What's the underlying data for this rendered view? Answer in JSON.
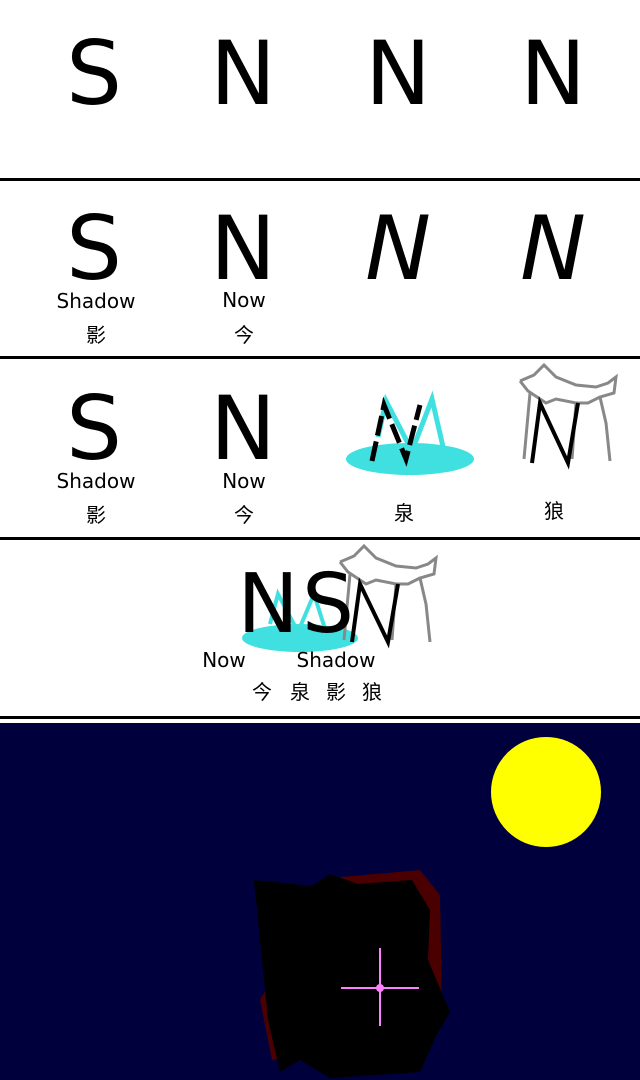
{
  "panel1": {
    "letters": [
      "S",
      "N",
      "N",
      "N"
    ]
  },
  "panel2": {
    "letters": [
      "S",
      "N",
      "N",
      "N"
    ],
    "words": [
      "Shadow",
      "Now"
    ],
    "kanji": [
      "影",
      "今"
    ]
  },
  "panel3": {
    "letters": [
      "S",
      "N",
      "N",
      "N"
    ],
    "words": [
      "Shadow",
      "Now"
    ],
    "kanji": [
      "影",
      "今",
      "泉",
      "狼"
    ]
  },
  "panel4": {
    "letters": [
      "N",
      "S"
    ],
    "words": [
      "Now",
      "Shadow"
    ],
    "kanji": [
      "今",
      "泉",
      "影",
      "狼"
    ]
  },
  "colors": {
    "divider": "#000000",
    "spring_water": "#40e0e0",
    "wolf_outline": "#888888",
    "night_sky": "#00003c",
    "moon": "#ffff00",
    "cursor": "#ff80ff",
    "figure": "#000000",
    "figure_edge": "#4a0000"
  }
}
